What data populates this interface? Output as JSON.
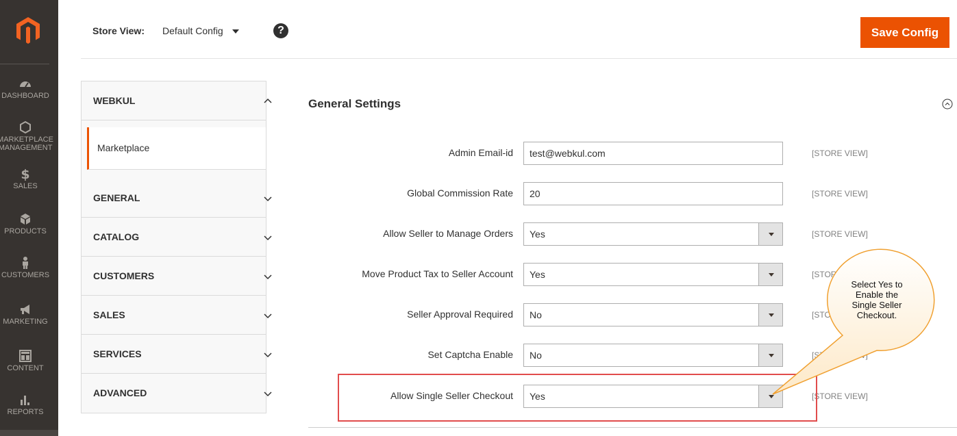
{
  "nav": {
    "items": [
      {
        "label": "DASHBOARD",
        "icon": "dashboard-gauge-icon"
      },
      {
        "label": "MARKETPLACE",
        "label2": "MANAGEMENT",
        "icon": "hexagon-icon"
      },
      {
        "label": "SALES",
        "icon": "dollar-icon"
      },
      {
        "label": "PRODUCTS",
        "icon": "cube-icon"
      },
      {
        "label": "CUSTOMERS",
        "icon": "person-icon"
      },
      {
        "label": "MARKETING",
        "icon": "megaphone-icon"
      },
      {
        "label": "CONTENT",
        "icon": "layout-icon"
      },
      {
        "label": "REPORTS",
        "icon": "bar-chart-icon"
      }
    ]
  },
  "topbar": {
    "store_view_label": "Store View:",
    "store_view_value": "Default Config",
    "help_symbol": "?",
    "save_label": "Save Config"
  },
  "tabs": {
    "webkul": "WEBKUL",
    "marketplace": "Marketplace",
    "general": "GENERAL",
    "catalog": "CATALOG",
    "customers": "CUSTOMERS",
    "sales": "SALES",
    "services": "SERVICES",
    "advanced": "ADVANCED"
  },
  "section": {
    "title": "General Settings",
    "rows": [
      {
        "label": "Admin Email-id",
        "value": "test@webkul.com",
        "scope": "[STORE VIEW]"
      },
      {
        "label": "Global Commission Rate",
        "value": "20",
        "scope": "[STORE VIEW]"
      },
      {
        "label": "Allow Seller to Manage Orders",
        "value": "Yes",
        "scope": "[STORE VIEW]"
      },
      {
        "label": "Move Product Tax to Seller Account",
        "value": "Yes",
        "scope": "[STORE VIEW]"
      },
      {
        "label": "Seller Approval Required",
        "value": "No",
        "scope": "[STORE VIEW]"
      },
      {
        "label": "Set Captcha Enable",
        "value": "No",
        "scope": "[STORE VIEW]"
      },
      {
        "label": "Allow Single Seller Checkout",
        "value": "Yes",
        "scope": "[STORE VIEW]"
      }
    ]
  },
  "callout": {
    "line1": "Select Yes to",
    "line2": "Enable the",
    "line3": "Single Seller",
    "line4": "Checkout."
  },
  "colors": {
    "accent": "#eb5202",
    "nav_bg": "#373330",
    "highlight": "#e14c4c",
    "callout_stroke": "#f0a030"
  }
}
